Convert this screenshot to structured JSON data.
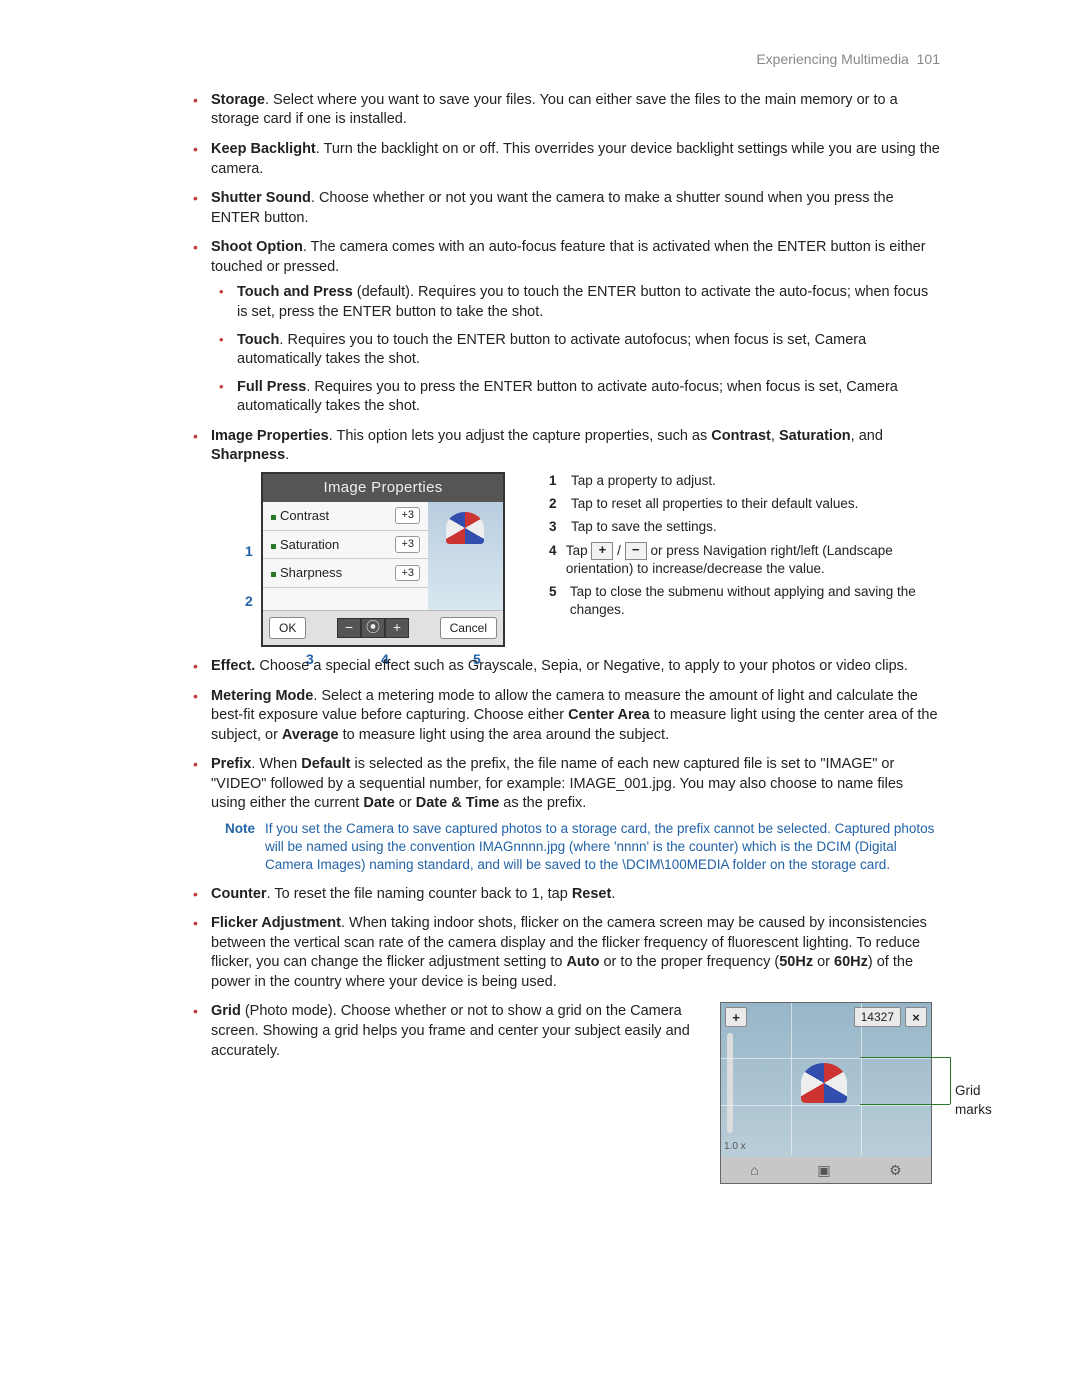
{
  "header": {
    "section": "Experiencing Multimedia",
    "page": "101"
  },
  "bullets": {
    "storage": {
      "title": "Storage",
      "text": ". Select where you want to save your files. You can either save the files to the main memory or to a storage card if one is installed."
    },
    "backlight": {
      "title": "Keep Backlight",
      "text": ". Turn the backlight on or off. This overrides your device backlight settings while you are using the camera."
    },
    "shutter": {
      "title": "Shutter Sound",
      "text": ". Choose whether or not you want the camera to make a shutter sound when you press the ENTER button."
    },
    "shoot": {
      "title": "Shoot Option",
      "text": ". The camera comes with an auto-focus feature that is activated when the ENTER button is either touched or pressed."
    },
    "shoot_sub": {
      "tp": {
        "title": "Touch and Press",
        "meta": " (default). ",
        "text": "Requires you to touch the ENTER button to activate the auto-focus; when focus is set, press the ENTER button to take the shot."
      },
      "touch": {
        "title": "Touch",
        "text": ". Requires you to touch the ENTER button to activate autofocus; when focus is set, Camera automatically takes the shot."
      },
      "full": {
        "title": "Full Press",
        "text": ". Requires you to press the ENTER button to activate auto-focus; when focus is set, Camera automatically takes the shot."
      }
    },
    "imgprops": {
      "title": "Image Properties",
      "pre": ". This option lets you adjust the capture properties, such as ",
      "c": "Contrast",
      "sep1": ", ",
      "s": "Saturation",
      "sep2": ", and ",
      "sh": "Sharpness",
      "post": "."
    },
    "effect": {
      "title": "Effect.",
      "text": " Choose a special effect such as Grayscale, Sepia, or Negative, to apply to your photos or video clips."
    },
    "metering": {
      "title": "Metering Mode",
      "t1": ". Select a metering mode to allow the camera to measure the amount of light and calculate the best-fit exposure value before capturing. Choose either ",
      "b1": "Center Area",
      "t2": " to measure light using the center area of the subject, or ",
      "b2": "Average",
      "t3": " to measure light using the area around the subject."
    },
    "prefix": {
      "title": "Prefix",
      "t1": ". When ",
      "b1": "Default",
      "t2": " is selected as the prefix, the file name of each new captured file is set to \"IMAGE\" or \"VIDEO\" followed by a sequential number, for example: IMAGE_001.jpg. You may also choose to name files using either the current ",
      "b2": "Date",
      "t3": " or ",
      "b3": "Date & Time",
      "t4": " as the prefix."
    },
    "counter": {
      "title": "Counter",
      "t1": ". To reset the file naming counter back to 1, tap ",
      "b1": "Reset",
      "t2": "."
    },
    "flicker": {
      "title": "Flicker Adjustment",
      "t1": ". When taking indoor shots, flicker on the camera screen may be caused by inconsistencies between the vertical scan rate of the camera display and the flicker frequency of fluorescent lighting. To reduce flicker, you can change the flicker adjustment setting to ",
      "b1": "Auto",
      "t2": " or to the proper frequency (",
      "b2": "50Hz",
      "t3": " or ",
      "b3": "60Hz",
      "t4": ") of the power in the country where your device is being used."
    },
    "grid": {
      "title": "Grid",
      "meta": " (Photo mode). ",
      "text": "Choose whether or not to show a grid on the Camera screen. Showing a grid helps you frame and center your subject easily and accurately."
    }
  },
  "note": {
    "label": "Note",
    "text": "If you set the Camera to save captured photos to a storage card, the prefix cannot be selected. Captured photos will be named using the convention IMAGnnnn.jpg (where 'nnnn' is the counter) which is the DCIM (Digital Camera Images) naming standard, and will be saved to the \\DCIM\\100MEDIA folder on the storage card."
  },
  "image_properties": {
    "title": "Image Properties",
    "rows": {
      "contrast": {
        "label": "Contrast",
        "value": "+3"
      },
      "saturation": {
        "label": "Saturation",
        "value": "+3"
      },
      "sharpness": {
        "label": "Sharpness",
        "value": "+3"
      }
    },
    "ok": "OK",
    "cancel": "Cancel",
    "minus": "−",
    "reset": "⦿",
    "plus": "+",
    "callouts": {
      "c1": "1",
      "c2": "2",
      "c3": "3",
      "c4": "4",
      "c5": "5"
    }
  },
  "numbered": {
    "n1": {
      "n": "1",
      "t": "Tap a property to adjust."
    },
    "n2": {
      "n": "2",
      "t": "Tap to reset all properties to their default values."
    },
    "n3": {
      "n": "3",
      "t": "Tap to save the settings."
    },
    "n4": {
      "n": "4",
      "pre": "Tap ",
      "sep": " / ",
      "post": " or press Navigation right/left (Landscape orientation) to increase/decrease the value."
    },
    "n5": {
      "n": "5",
      "t": "Tap to close the submenu without applying and saving the changes."
    }
  },
  "camera": {
    "count": "14327",
    "plus": "+",
    "close": "×",
    "zoom": "1.0 x",
    "home_icon": "⌂",
    "camera_icon": "▣",
    "gear_icon": "⚙",
    "grid_label": "Grid marks"
  }
}
